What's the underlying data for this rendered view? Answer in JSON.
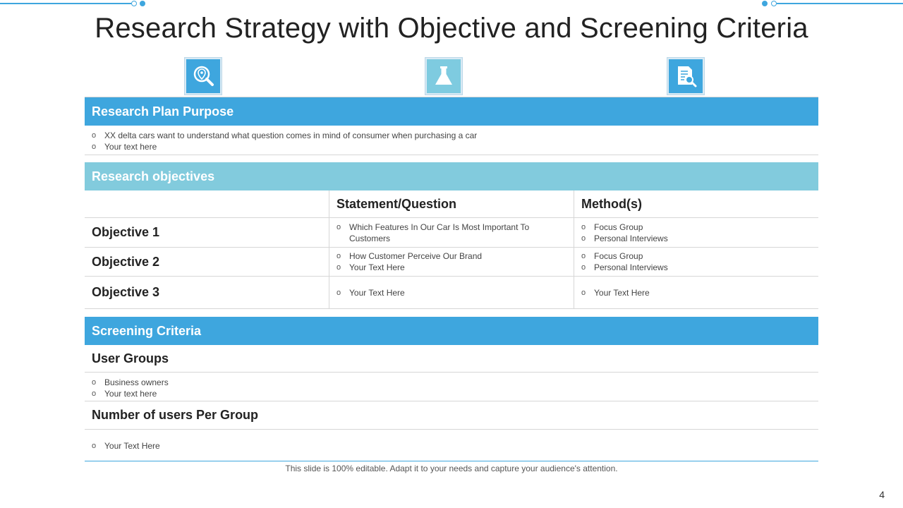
{
  "title": "Research Strategy with Objective and Screening Criteria",
  "colors": {
    "accent": "#3ea6de",
    "teal": "#82cbdd"
  },
  "icons": [
    "location-search-icon",
    "flask-icon",
    "document-search-icon"
  ],
  "purpose": {
    "heading": "Research Plan Purpose",
    "bullets": [
      "XX  delta cars want to understand  what question comes in mind of consumer when purchasing  a car",
      "Your text here"
    ]
  },
  "objectives": {
    "heading": "Research objectives",
    "columns": [
      "",
      "Statement/Question",
      "Method(s)"
    ],
    "rows": [
      {
        "label": "Objective 1",
        "statements": [
          "Which Features In Our Car Is Most Important To Customers"
        ],
        "methods": [
          "Focus Group",
          "Personal Interviews"
        ]
      },
      {
        "label": "Objective 2",
        "statements": [
          "How Customer Perceive Our Brand",
          "Your Text Here"
        ],
        "methods": [
          "Focus Group",
          "Personal Interviews"
        ]
      },
      {
        "label": "Objective 3",
        "statements": [
          "Your Text Here"
        ],
        "methods": [
          "Your Text Here"
        ]
      }
    ]
  },
  "screening": {
    "heading": "Screening Criteria",
    "user_groups_label": "User Groups",
    "user_groups": [
      "Business owners",
      "Your text here"
    ],
    "users_per_group_label": "Number of users Per Group",
    "users_per_group": [
      "Your Text Here"
    ]
  },
  "footnote": "This slide is 100% editable. Adapt it to your needs and capture your audience's attention.",
  "page_number": "4",
  "bullet_marker": "o"
}
